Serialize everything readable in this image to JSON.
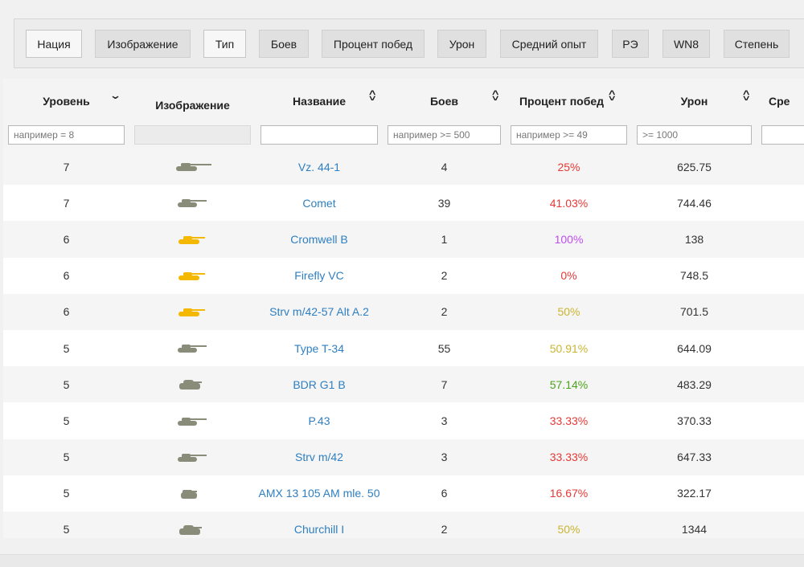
{
  "toggles": [
    {
      "label": "Нация",
      "active": true
    },
    {
      "label": "Изображение",
      "active": false
    },
    {
      "label": "Тип",
      "active": true
    },
    {
      "label": "Боев",
      "active": false
    },
    {
      "label": "Процент побед",
      "active": false
    },
    {
      "label": "Урон",
      "active": false
    },
    {
      "label": "Средний опыт",
      "active": false
    },
    {
      "label": "РЭ",
      "active": false
    },
    {
      "label": "WN8",
      "active": false
    },
    {
      "label": "Степень",
      "active": false
    }
  ],
  "table": {
    "headers": {
      "level": "Уровень",
      "image": "Изображение",
      "name": "Название",
      "battles": "Боев",
      "winrate": "Процент побед",
      "damage": "Урон",
      "avgxp": "Сре"
    },
    "placeholders": {
      "level": "например = 8",
      "battles": "например >= 500",
      "winrate": "например >= 49",
      "damage": ">= 1000"
    },
    "rows": [
      {
        "level": "7",
        "name": "Vz. 44-1",
        "battles": "4",
        "winrate": "25%",
        "winrate_color": "#e53935",
        "damage": "625.75",
        "tank_color": "#8a8c7a",
        "tank_icon": "heavy-tank-long-gun"
      },
      {
        "level": "7",
        "name": "Comet",
        "battles": "39",
        "winrate": "41.03%",
        "winrate_color": "#e53935",
        "damage": "744.46",
        "tank_color": "#8a8c7a",
        "tank_icon": "medium-tank"
      },
      {
        "level": "6",
        "name": "Cromwell B",
        "battles": "1",
        "winrate": "100%",
        "winrate_color": "#c04ef0",
        "damage": "138",
        "tank_color": "#f5b800",
        "tank_icon": "premium-medium-tank"
      },
      {
        "level": "6",
        "name": "Firefly VC",
        "battles": "2",
        "winrate": "0%",
        "winrate_color": "#e53935",
        "damage": "748.5",
        "tank_color": "#f5b800",
        "tank_icon": "premium-medium-tank"
      },
      {
        "level": "6",
        "name": "Strv m/42-57 Alt A.2",
        "battles": "2",
        "winrate": "50%",
        "winrate_color": "#c9b531",
        "damage": "701.5",
        "tank_color": "#f5b800",
        "tank_icon": "premium-medium-tank"
      },
      {
        "level": "5",
        "name": "Type T-34",
        "battles": "55",
        "winrate": "50.91%",
        "winrate_color": "#c9b531",
        "damage": "644.09",
        "tank_color": "#8a8c7a",
        "tank_icon": "medium-tank"
      },
      {
        "level": "5",
        "name": "BDR G1 B",
        "battles": "7",
        "winrate": "57.14%",
        "winrate_color": "#4aa31b",
        "damage": "483.29",
        "tank_color": "#8a8c7a",
        "tank_icon": "heavy-tank"
      },
      {
        "level": "5",
        "name": "P.43",
        "battles": "3",
        "winrate": "33.33%",
        "winrate_color": "#e53935",
        "damage": "370.33",
        "tank_color": "#8a8c7a",
        "tank_icon": "medium-tank"
      },
      {
        "level": "5",
        "name": "Strv m/42",
        "battles": "3",
        "winrate": "33.33%",
        "winrate_color": "#e53935",
        "damage": "647.33",
        "tank_color": "#8a8c7a",
        "tank_icon": "medium-tank"
      },
      {
        "level": "5",
        "name": "AMX 13 105 AM mle. 50",
        "battles": "6",
        "winrate": "16.67%",
        "winrate_color": "#e53935",
        "damage": "322.17",
        "tank_color": "#8a8c7a",
        "tank_icon": "spg"
      },
      {
        "level": "5",
        "name": "Churchill I",
        "battles": "2",
        "winrate": "50%",
        "winrate_color": "#c9b531",
        "damage": "1344",
        "tank_color": "#8a8c7a",
        "tank_icon": "heavy-tank"
      }
    ]
  }
}
